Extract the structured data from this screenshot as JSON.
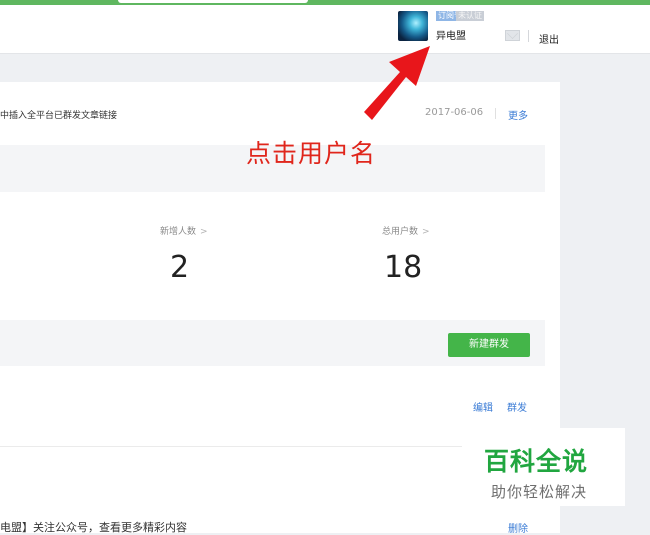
{
  "header": {
    "account_type_badge": "订阅号",
    "verify_badge": "未认证",
    "username": "异电盟",
    "logout": "退出",
    "mail_icon": "mail-icon"
  },
  "notice": {
    "text": "中插入全平台已群发文章链接",
    "date": "2017-06-06",
    "more": "更多"
  },
  "annotation": {
    "text": "点击用户名",
    "color": "#e0261c"
  },
  "stats": [
    {
      "label": "新增人数",
      "value": "2"
    },
    {
      "label": "总用户数",
      "value": "18"
    }
  ],
  "actions": {
    "new_mass": "新建群发",
    "edit": "编辑",
    "mass_send": "群发",
    "delete": "删除"
  },
  "message_row": {
    "text": "电盟】关注公众号，查看更多精彩内容"
  },
  "watermark": {
    "title": "百科全说",
    "subtitle": "助你轻松解决"
  },
  "colors": {
    "accent_green": "#44b549",
    "link_blue": "#3a7bd5",
    "top_bar": "#5fb760"
  }
}
